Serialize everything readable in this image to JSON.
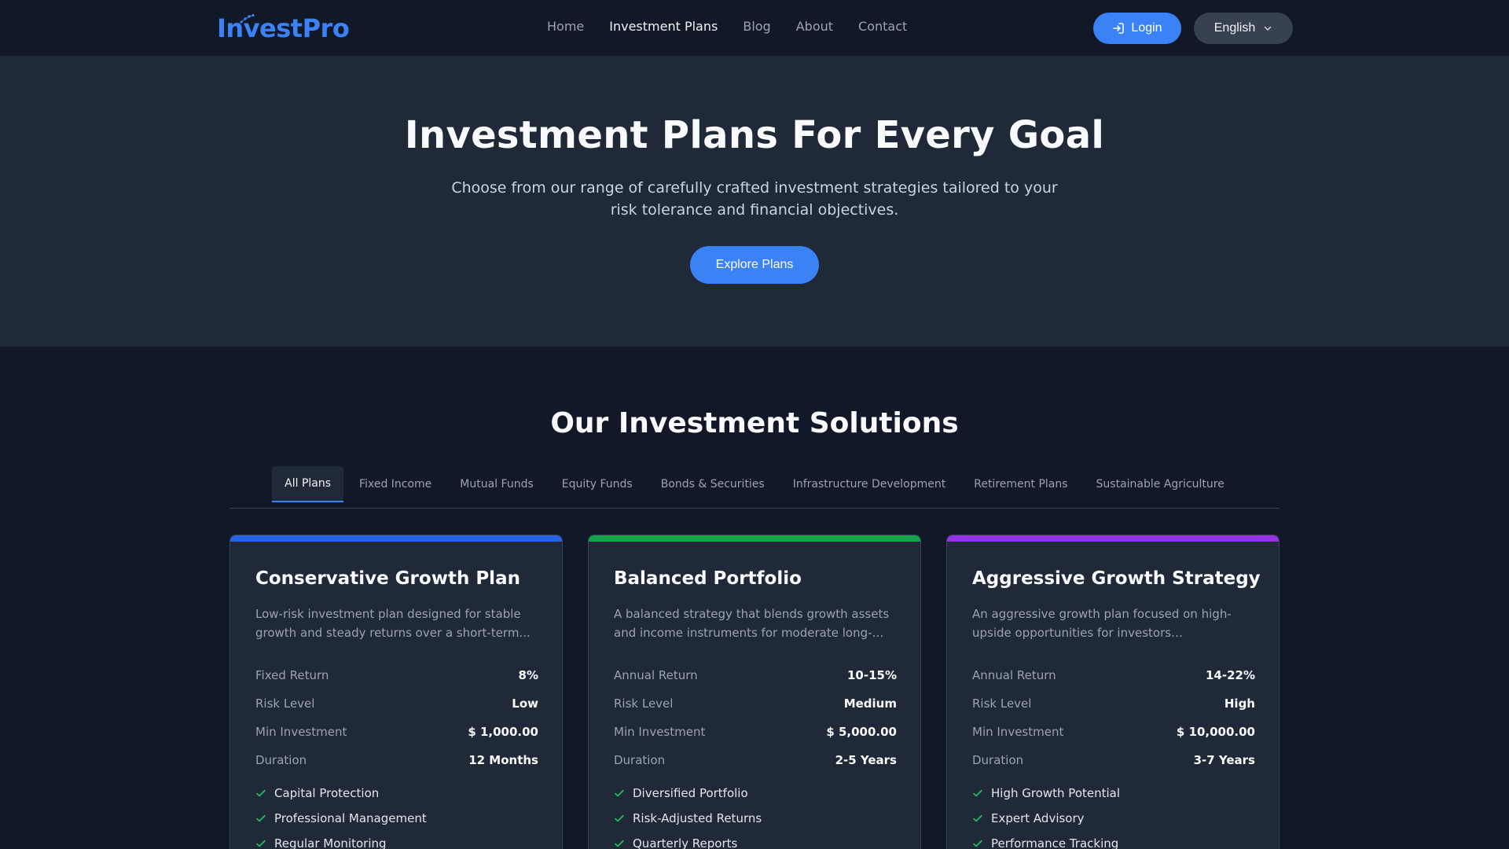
{
  "brand": {
    "logo_text": "InvestPro"
  },
  "nav": {
    "links": [
      "Home",
      "Investment Plans",
      "Blog",
      "About",
      "Contact"
    ],
    "active_index": 1,
    "login_label": "Login",
    "language_label": "English"
  },
  "hero": {
    "title": "Investment Plans For Every Goal",
    "subtitle": "Choose from our range of carefully crafted investment strategies tailored to your risk tolerance and financial objectives.",
    "cta_label": "Explore Plans"
  },
  "solutions": {
    "title": "Our Investment Solutions",
    "tabs": [
      "All Plans",
      "Fixed Income",
      "Mutual Funds",
      "Equity Funds",
      "Bonds & Securities",
      "Infrastructure Development",
      "Retirement Plans",
      "Sustainable Agriculture"
    ],
    "active_tab": 0
  },
  "cards": [
    {
      "accent": "#2563eb",
      "title": "Conservative Growth Plan",
      "description": "Low-risk investment plan designed for stable growth and steady returns over a short-term...",
      "stats": [
        {
          "label": "Fixed Return",
          "value": "8%"
        },
        {
          "label": "Risk Level",
          "value": "Low"
        },
        {
          "label": "Min Investment",
          "value": "$ 1,000.00"
        },
        {
          "label": "Duration",
          "value": "12 Months"
        }
      ],
      "features": [
        "Capital Protection",
        "Professional Management",
        "Regular Monitoring"
      ]
    },
    {
      "accent": "#16a34a",
      "title": "Balanced Portfolio",
      "description": "A balanced strategy that blends growth assets and income instruments for moderate long-ter...",
      "stats": [
        {
          "label": "Annual Return",
          "value": "10-15%"
        },
        {
          "label": "Risk Level",
          "value": "Medium"
        },
        {
          "label": "Min Investment",
          "value": "$ 5,000.00"
        },
        {
          "label": "Duration",
          "value": "2-5 Years"
        }
      ],
      "features": [
        "Diversified Portfolio",
        "Risk-Adjusted Returns",
        "Quarterly Reports"
      ]
    },
    {
      "accent": "#9333ea",
      "title": "Aggressive Growth Strategy",
      "description": "An aggressive growth plan focused on high-upside opportunities for investors comfortable...",
      "stats": [
        {
          "label": "Annual Return",
          "value": "14-22%"
        },
        {
          "label": "Risk Level",
          "value": "High"
        },
        {
          "label": "Min Investment",
          "value": "$ 10,000.00"
        },
        {
          "label": "Duration",
          "value": "3-7 Years"
        }
      ],
      "features": [
        "High Growth Potential",
        "Expert Advisory",
        "Performance Tracking"
      ]
    }
  ],
  "icons": {
    "login": "login-icon",
    "chevron": "chevron-down-icon",
    "check": "check-icon",
    "check_color": "#22c55e"
  },
  "colors": {
    "accent": "#3b82f6",
    "background": "#111827",
    "surface": "#1f2937"
  }
}
